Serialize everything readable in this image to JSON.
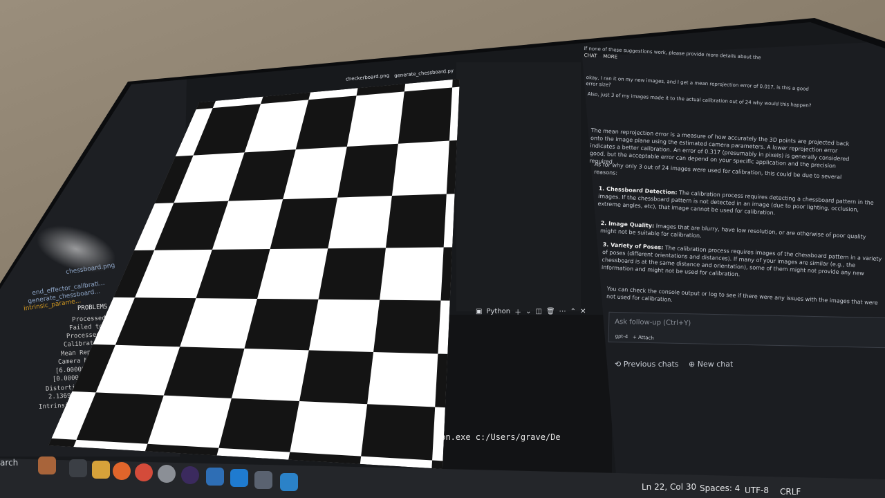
{
  "window_tabs": [
    "checkerboard.png",
    "generate_chessboard.py"
  ],
  "sidebar": {
    "items": [
      "chessboard.png",
      "end_effector_calibrati...",
      "generate_chessboard...",
      "intrinsic_parame..."
    ]
  },
  "problems_panel": {
    "title": "PROBLEMS",
    "lines": [
      "Processed 18/",
      "Failed to add",
      "Processed 24/",
      "Calibration s",
      "Mean Reproject",
      "Camera Matrix:",
      "[6.0000000e+",
      "[0.0000000e+",
      "Distortion Co",
      "2.1369585",
      "Intrinsic par"
    ]
  },
  "terminal": {
    "profile": "Python",
    "command": "hon.exe c:/Users/grave/De"
  },
  "chat": {
    "header_tabs": [
      "CHAT",
      "MORE"
    ],
    "intro": "If none of these suggestions work, please provide more details about the",
    "user_q1": "okay, I ran it on my new images, and I get a mean reprojection error of 0.017, is this a good error size?",
    "user_q2": "Also, just 3 of my images made it to the actual calibration out of 24 why would this happen?",
    "para1": "The mean reprojection error is a measure of how accurately the 3D points are projected back onto the image plane using the estimated camera parameters. A lower reprojection error indicates a better calibration. An error of 0.317 (presumably in pixels) is generally considered good, but the acceptable error can depend on your specific application and the precision required.",
    "para2": "As for why only 3 out of 24 images were used for calibration, this could be due to several reasons:",
    "point1_title": "1. Chessboard Detection:",
    "point1": "The calibration process requires detecting a chessboard pattern in the images. If the chessboard pattern is not detected in an image (due to poor lighting, occlusion, extreme angles, etc), that image cannot be used for calibration.",
    "point2_title": "2. Image Quality:",
    "point2": "Images that are blurry, have low resolution, or are otherwise of poor quality might not be suitable for calibration.",
    "point3_title": "3. Variety of Poses:",
    "point3": "The calibration process requires images of the chessboard pattern in a variety of poses (different orientations and distances). If many of your images are similar (e.g., the chessboard is at the same distance and orientation), some of them might not provide any new information and might not be used for calibration.",
    "closing": "You can check the console output or log to see if there were any issues with the images that were not used for calibration.",
    "followup_placeholder": "Ask follow-up (Ctrl+Y)",
    "model": "gpt-4",
    "attach": "+ Attach",
    "previous_chats": "Previous chats",
    "new_chat": "New chat"
  },
  "statusbar": {
    "position": "Ln 22, Col 30",
    "spaces": "Spaces: 4",
    "encoding": "UTF-8",
    "eol": "CRLF"
  },
  "taskbar": {
    "search": "arch"
  },
  "chessboard": {
    "rows": 7,
    "cols": 5,
    "dark_color": "#141414",
    "light_color": "#ffffff"
  }
}
